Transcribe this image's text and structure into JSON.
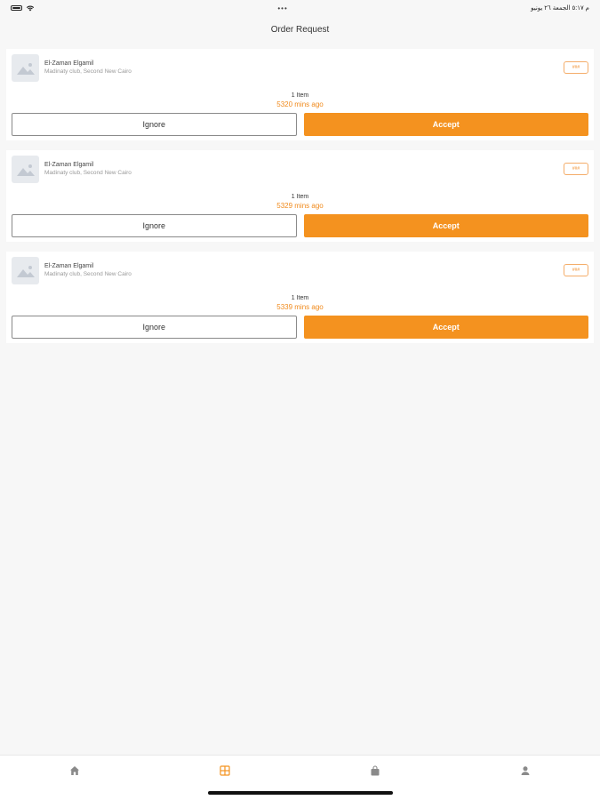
{
  "status_bar": {
    "right_text": "م ٥:١٧ الجمعة ٢٦ يونيو",
    "center_dots": "•••"
  },
  "header": {
    "title": "Order Request"
  },
  "orders": [
    {
      "shop_name": "El-Zaman Elgamil",
      "address": "Madinaty club, Second New Cairo",
      "badge": "###",
      "items": "1 Item",
      "time_ago": "5320 mins ago",
      "ignore_label": "Ignore",
      "accept_label": "Accept"
    },
    {
      "shop_name": "El-Zaman Elgamil",
      "address": "Madinaty club, Second New Cairo",
      "badge": "###",
      "items": "1 Item",
      "time_ago": "5329 mins ago",
      "ignore_label": "Ignore",
      "accept_label": "Accept"
    },
    {
      "shop_name": "El-Zaman Elgamil",
      "address": "Madinaty club, Second New Cairo",
      "badge": "###",
      "items": "1 Item",
      "time_ago": "5339 mins ago",
      "ignore_label": "Ignore",
      "accept_label": "Accept"
    }
  ],
  "tabs": [
    {
      "icon": "home-icon",
      "active": false
    },
    {
      "icon": "orders-icon",
      "active": true
    },
    {
      "icon": "bag-icon",
      "active": false
    },
    {
      "icon": "profile-icon",
      "active": false
    }
  ],
  "colors": {
    "accent": "#f4921f",
    "inactive_icon": "#8a8a8a",
    "background": "#f7f7f7"
  }
}
